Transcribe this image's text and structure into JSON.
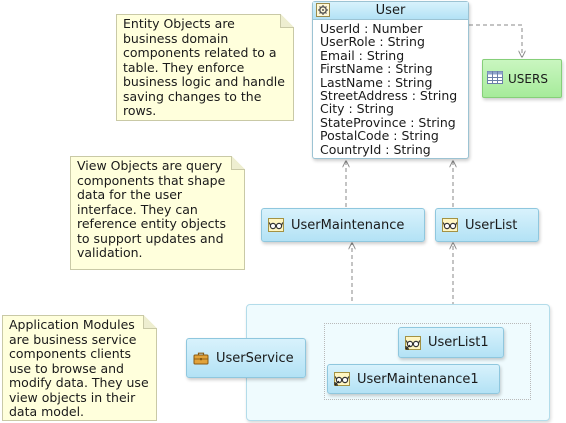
{
  "notes": {
    "entity": "Entity Objects are business domain components related to a table. They enforce business logic and handle saving changes to the rows.",
    "view": "View Objects are query components that shape data for the user interface. They can reference entity objects to support updates and validation.",
    "app": "Application Modules are business service components clients use to browse and modify data. They use view objects in their data model."
  },
  "entity": {
    "name": "User",
    "attributes": [
      "UserId  : Number",
      "UserRole  : String",
      "Email  : String",
      "FirstName  : String",
      "LastName  : String",
      "StreetAddress  : String",
      "City  : String",
      "StateProvince  : String",
      "PostalCode  : String",
      "CountryId  : String"
    ]
  },
  "table": {
    "name": "USERS"
  },
  "view_objects": {
    "maintenance": "UserMaintenance",
    "list": "UserList"
  },
  "app_module": {
    "name": "UserService",
    "instances": {
      "list1": "UserList1",
      "maintenance1": "UserMaintenance1"
    }
  },
  "icons": {
    "entity": "gear-entity-icon",
    "table": "table-grid-icon",
    "view_object": "view-object-glasses-icon",
    "app_module": "briefcase-icon"
  },
  "colors": {
    "note_bg": "#ffffdc",
    "node_fill": "#b3e2f5",
    "table_fill": "#a6eb9a",
    "container_bg": "#effbfe"
  }
}
